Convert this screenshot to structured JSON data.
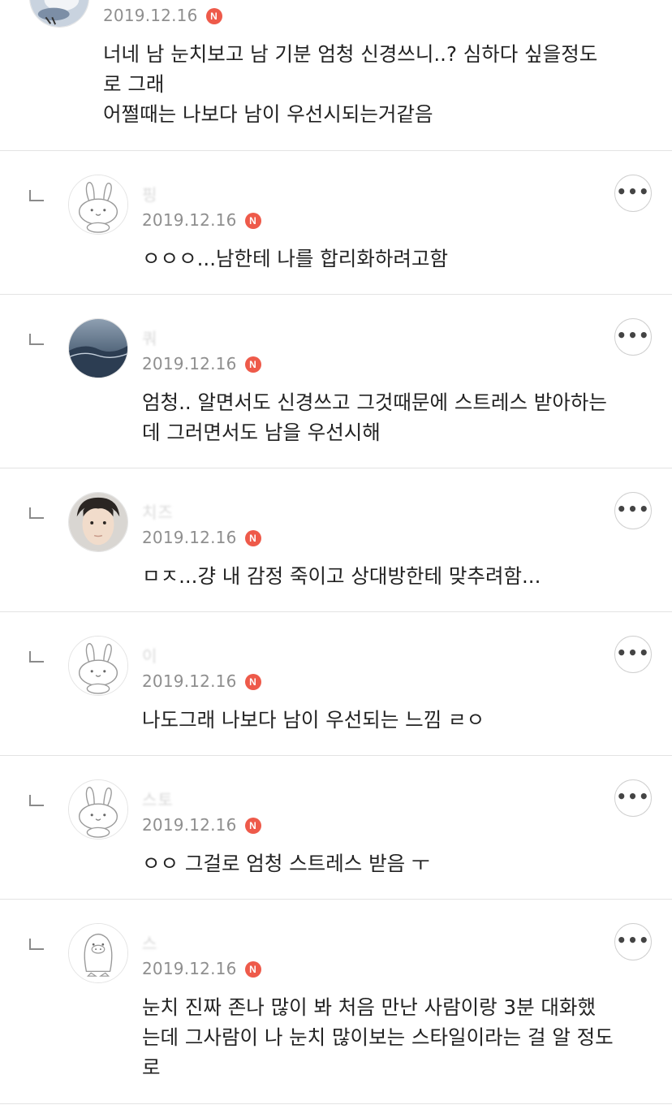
{
  "comments": [
    {
      "date": "2019.12.16",
      "badge": "N",
      "text": "너네 남 눈치보고 남 기분 엄청 신경쓰니..? 심하다 싶을정도\n로 그래\n어쩔때는 나보다 남이 우선시되는거같음",
      "avatar": "bird-photo"
    },
    {
      "name": "핑",
      "date": "2019.12.16",
      "badge": "N",
      "text": "ㅇㅇㅇ...남한테 나를 합리화하려고함",
      "avatar": "bunny-default"
    },
    {
      "name": "쿼",
      "date": "2019.12.16",
      "badge": "N",
      "text": "엄청.. 알면서도 신경쓰고 그것때문에 스트레스 받아하는\n데 그러면서도 남을 우선시해",
      "avatar": "ocean-photo"
    },
    {
      "name": "치즈",
      "date": "2019.12.16",
      "badge": "N",
      "text": "ㅁㅈ...걍 내 감정 죽이고 상대방한테 맞추려함...",
      "avatar": "person-photo"
    },
    {
      "name": "이",
      "date": "2019.12.16",
      "badge": "N",
      "text": "나도그래 나보다 남이 우선되는 느낌 ㄹㅇ",
      "avatar": "bunny-default"
    },
    {
      "name": "스토",
      "date": "2019.12.16",
      "badge": "N",
      "text": "ㅇㅇ 그걸로 엄청 스트레스 받음 ㅜ",
      "avatar": "bunny-default"
    },
    {
      "name": "스",
      "date": "2019.12.16",
      "badge": "N",
      "text": "눈치 진짜 존나 많이 봐 처음 만난 사람이랑 3분 대화했\n는데 그사람이 나 눈치 많이보는 스타일이라는 걸 알 정도\n로",
      "avatar": "penguin-default"
    }
  ],
  "more_label": "•••",
  "colors": {
    "badge": "#ee5a4a",
    "divider": "#e3e3e3",
    "date": "#8f8f8f"
  }
}
